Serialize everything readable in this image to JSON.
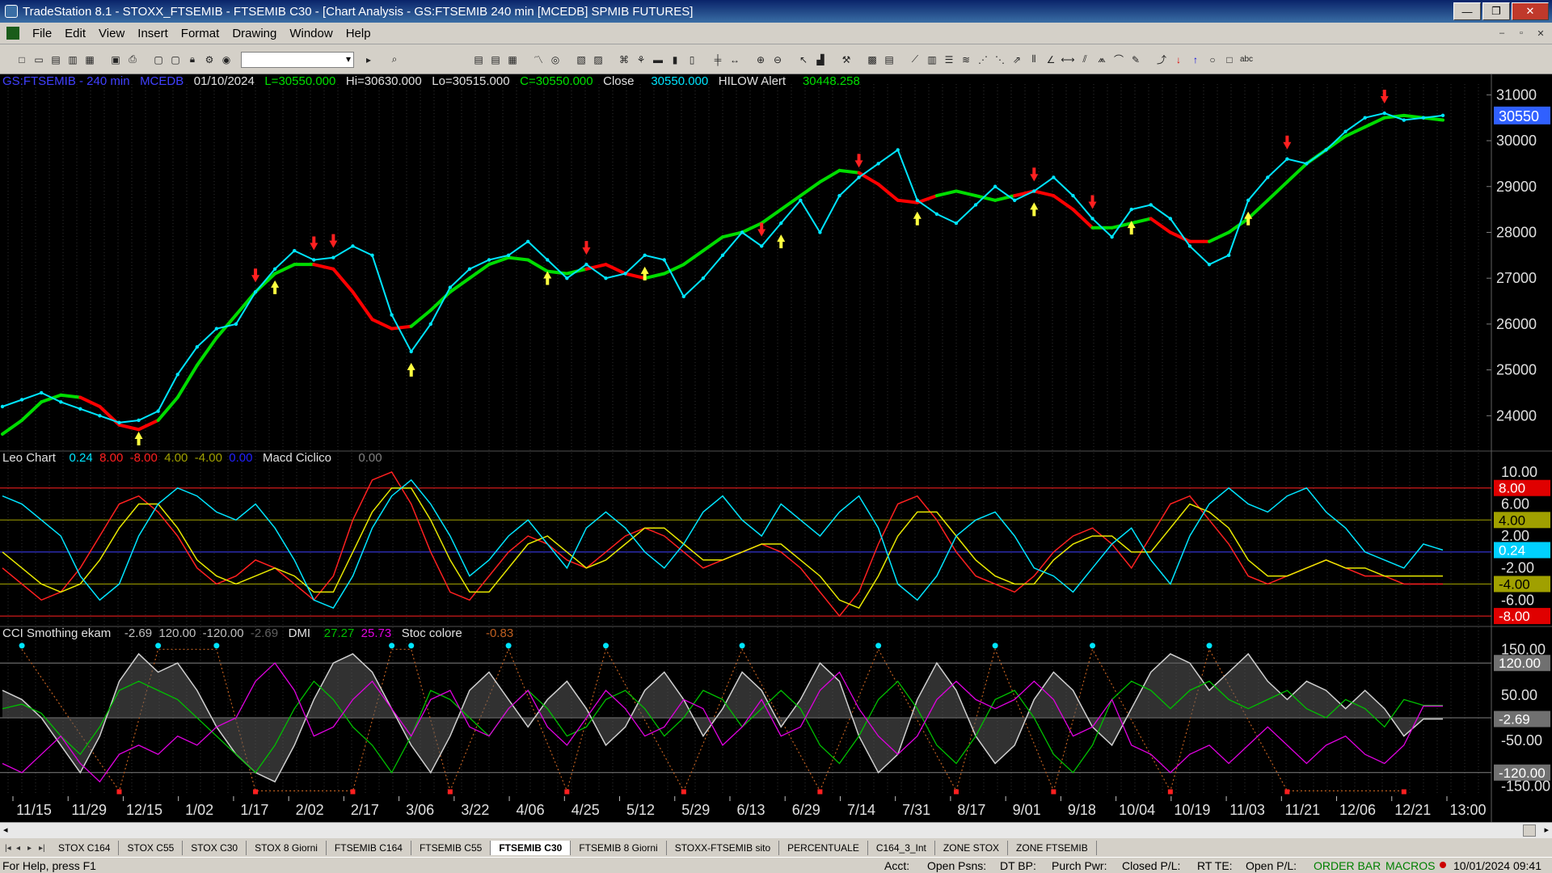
{
  "window": {
    "title": "TradeStation 8.1 - STOXX_FTSEMIB - FTSEMIB C30 - [Chart Analysis - GS:FTSEMIB  240 min  [MCEDB] SPMIB FUTURES]",
    "minimize": "—",
    "restore": "❐",
    "close": "✕"
  },
  "menu": [
    "File",
    "Edit",
    "View",
    "Insert",
    "Format",
    "Drawing",
    "Window",
    "Help"
  ],
  "mdi": {
    "minimize": "–",
    "restore": "▫",
    "close": "✕"
  },
  "chart_header": {
    "symbol": "GS:FTSEMIB - 240 min",
    "datasource": "MCEDB",
    "date": "01/10/2024",
    "last": "L=30550.000",
    "high": "Hi=30630.000",
    "low": "Lo=30515.000",
    "close": "C=30550.000",
    "close_label": "Close",
    "close_value": "30550.000",
    "study": "HILOW Alert",
    "study_value": "30448.258"
  },
  "panel2_header": {
    "name": "Leo Chart",
    "v1": "0.24",
    "v2": "8.00",
    "v3": "-8.00",
    "v4": "4.00",
    "v5": "-4.00",
    "v6": "0.00",
    "name2": "Macd Ciclico",
    "v7": "0.00"
  },
  "panel3_header": {
    "name": "CCI Smothing ekam",
    "v1": "-2.69",
    "v2": "120.00",
    "v3": "-120.00",
    "v4": "-2.69",
    "name2": "DMI",
    "v5": "27.27",
    "v6": "25.73",
    "name3": "Stoc colore",
    "v7": "-0.83"
  },
  "colors": {
    "price": "#00e5ff",
    "ma_up": "#00dd00",
    "ma_down": "#ff0000",
    "osc_line": "#00e5ff",
    "signal_red": "#ff2020",
    "signal_yellow": "#e8e800",
    "dmi_plus": "#00c000",
    "dmi_minus": "#e000e0",
    "stoc": "#c06020"
  },
  "price_axis": [
    "31000",
    "30000",
    "29000",
    "28000",
    "27000",
    "26000",
    "25000",
    "24000"
  ],
  "price_current": "30550",
  "osc_axis": [
    "10.00",
    "6.00",
    "2.00",
    "-2.00",
    "-6.00"
  ],
  "osc_badges": [
    "8.00",
    "4.00",
    "0.24",
    "-4.00",
    "-8.00"
  ],
  "cci_axis": [
    "150.00",
    "50.00",
    "-50.00",
    "-150.00"
  ],
  "cci_badges": [
    "120.00",
    "-2.69",
    "-120.00"
  ],
  "date_axis": [
    "11/15",
    "11/29",
    "12/15",
    "1/02",
    "1/17",
    "2/02",
    "2/17",
    "3/06",
    "3/22",
    "4/06",
    "4/25",
    "5/12",
    "5/29",
    "6/13",
    "6/29",
    "7/14",
    "7/31",
    "8/17",
    "9/01",
    "9/18",
    "10/04",
    "10/19",
    "11/03",
    "11/21",
    "12/06",
    "12/21",
    "13:00"
  ],
  "tabs": [
    "STOX C164",
    "STOX C55",
    "STOX  C30",
    "STOX  8 Giorni",
    "FTSEMIB C164",
    "FTSEMIB C55",
    "FTSEMIB C30",
    "FTSEMIB  8 Giorni",
    "STOXX-FTSEMIB sito",
    "PERCENTUALE",
    "C164_3_Int",
    "ZONE STOX",
    "ZONE FTSEMIB"
  ],
  "active_tab": "FTSEMIB C30",
  "status": {
    "help": "For Help, press F1",
    "acct": "Acct:",
    "open_psns": "Open Psns:",
    "dt_bp": "DT BP:",
    "purch_pwr": "Purch Pwr:",
    "closed_pl": "Closed P/L:",
    "rt_te": "RT TE:",
    "open_pl": "Open P/L:",
    "order_bar": "ORDER BAR",
    "macros": "MACROS",
    "datetime": "10/01/2024 09:41"
  },
  "chart_data": {
    "type": "line",
    "x_ticks": [
      "11/15",
      "11/29",
      "12/15",
      "1/02",
      "1/17",
      "2/02",
      "2/17",
      "3/06",
      "3/22",
      "4/06",
      "4/25",
      "5/12",
      "5/29",
      "6/13",
      "6/29",
      "7/14",
      "7/31",
      "8/17",
      "9/01",
      "9/18",
      "10/04",
      "10/19",
      "11/03",
      "11/21",
      "12/06",
      "12/21",
      "13:00"
    ],
    "price": {
      "ylim": [
        23300,
        31200
      ],
      "close": [
        24200,
        24350,
        24500,
        24300,
        24150,
        24000,
        23850,
        23900,
        24100,
        24900,
        25500,
        25900,
        26000,
        26700,
        27200,
        27600,
        27400,
        27450,
        27700,
        27500,
        26200,
        25400,
        26000,
        26800,
        27200,
        27400,
        27500,
        27800,
        27400,
        27000,
        27300,
        27000,
        27100,
        27500,
        27400,
        26600,
        27000,
        27500,
        28000,
        27700,
        28200,
        28700,
        28000,
        28800,
        29200,
        29500,
        29800,
        28700,
        28400,
        28200,
        28600,
        29000,
        28700,
        28900,
        29200,
        28800,
        28300,
        27900,
        28500,
        28600,
        28300,
        27700,
        27300,
        27500,
        28700,
        29200,
        29600,
        29500,
        29800,
        30200,
        30500,
        30600,
        30450,
        30500,
        30550
      ],
      "hilow": [
        23600,
        23900,
        24300,
        24450,
        24400,
        24200,
        23800,
        23700,
        23900,
        24400,
        25100,
        25700,
        26200,
        26700,
        27100,
        27300,
        27300,
        27200,
        26700,
        26100,
        25900,
        25950,
        26300,
        26700,
        27000,
        27300,
        27450,
        27400,
        27150,
        27100,
        27200,
        27300,
        27100,
        27000,
        27100,
        27300,
        27600,
        27900,
        28000,
        28200,
        28500,
        28800,
        29100,
        29350,
        29300,
        29050,
        28700,
        28650,
        28800,
        28900,
        28800,
        28700,
        28800,
        28900,
        28800,
        28500,
        28100,
        28100,
        28200,
        28300,
        28000,
        27800,
        27800,
        28000,
        28300,
        28700,
        29100,
        29500,
        29800,
        30100,
        30300,
        30500,
        30550,
        30500,
        30450
      ],
      "hilow_down_segments": [
        [
          4,
          8
        ],
        [
          16,
          21
        ],
        [
          30,
          33
        ],
        [
          44,
          48
        ],
        [
          52,
          56
        ],
        [
          59,
          62
        ]
      ],
      "sell_signals_idx": [
        13,
        16,
        17,
        30,
        39,
        44,
        53,
        56,
        66,
        71
      ],
      "buy_signals_idx": [
        7,
        14,
        21,
        28,
        33,
        40,
        47,
        53,
        58,
        64
      ]
    },
    "oscillator": {
      "ylim": [
        -9,
        11
      ],
      "levels": [
        8,
        4,
        0,
        -4,
        -8
      ],
      "leo": [
        7,
        6,
        4,
        2,
        -3,
        -6,
        -4,
        2,
        6,
        8,
        7,
        5,
        4,
        6,
        3,
        -1,
        -6,
        -7,
        -3,
        3,
        7,
        9,
        6,
        2,
        -3,
        -1,
        2,
        4,
        1,
        -2,
        3,
        5,
        3,
        0,
        -2,
        1,
        5,
        7,
        4,
        2,
        6,
        4,
        2,
        5,
        7,
        3,
        -4,
        -6,
        -3,
        2,
        4,
        5,
        2,
        -2,
        -3,
        -5,
        -2,
        1,
        3,
        -1,
        -4,
        2,
        6,
        8,
        6,
        5,
        7,
        8,
        5,
        3,
        0,
        -1,
        -2,
        1,
        0.24
      ],
      "macd_red": [
        -2,
        -4,
        -6,
        -5,
        -2,
        2,
        6,
        7,
        5,
        2,
        -2,
        -4,
        -3,
        -1,
        -2,
        -4,
        -6,
        -3,
        4,
        9,
        10,
        6,
        0,
        -5,
        -6,
        -3,
        0,
        2,
        1,
        -1,
        -2,
        0,
        2,
        3,
        2,
        0,
        -2,
        -1,
        0,
        1,
        0,
        -2,
        -5,
        -8,
        -5,
        1,
        6,
        7,
        4,
        0,
        -3,
        -4,
        -5,
        -3,
        0,
        2,
        3,
        1,
        -2,
        2,
        6,
        7,
        4,
        1,
        -3,
        -4,
        -3,
        -2,
        -1,
        -2,
        -3,
        -3,
        -4,
        -4,
        -4
      ],
      "macd_yellow": [
        0,
        -2,
        -4,
        -5,
        -4,
        -1,
        3,
        6,
        6,
        3,
        -1,
        -3,
        -4,
        -3,
        -2,
        -3,
        -5,
        -5,
        0,
        5,
        8,
        8,
        4,
        -1,
        -5,
        -5,
        -2,
        1,
        2,
        0,
        -2,
        -1,
        1,
        3,
        3,
        1,
        -1,
        -1,
        0,
        1,
        1,
        -1,
        -3,
        -6,
        -7,
        -3,
        2,
        5,
        5,
        2,
        -1,
        -3,
        -4,
        -4,
        -1,
        1,
        2,
        2,
        0,
        0,
        3,
        6,
        5,
        3,
        -1,
        -3,
        -3,
        -2,
        -1,
        -2,
        -2,
        -3,
        -3,
        -3,
        -3
      ]
    },
    "cci": {
      "ylim": [
        -170,
        170
      ],
      "levels": [
        120,
        0,
        -120
      ],
      "cci": [
        60,
        40,
        0,
        -60,
        -120,
        -40,
        80,
        140,
        100,
        120,
        60,
        -20,
        -80,
        -120,
        -140,
        -60,
        40,
        120,
        140,
        100,
        20,
        -60,
        -120,
        -40,
        60,
        100,
        40,
        -20,
        40,
        80,
        20,
        -60,
        -20,
        60,
        100,
        40,
        -40,
        20,
        100,
        60,
        -20,
        40,
        120,
        80,
        -40,
        -120,
        -80,
        40,
        120,
        60,
        -40,
        -100,
        -60,
        40,
        100,
        60,
        -20,
        -60,
        20,
        100,
        140,
        120,
        60,
        100,
        140,
        80,
        40,
        80,
        60,
        20,
        60,
        20,
        -40,
        -2.69,
        -2.69
      ],
      "dmi_plus": [
        20,
        30,
        10,
        -40,
        -80,
        -20,
        60,
        80,
        60,
        40,
        0,
        -40,
        -80,
        -120,
        -60,
        20,
        80,
        40,
        -20,
        -60,
        -120,
        -40,
        60,
        40,
        0,
        -40,
        20,
        60,
        20,
        -40,
        -20,
        40,
        60,
        20,
        -40,
        0,
        60,
        40,
        -20,
        20,
        60,
        20,
        -60,
        -100,
        -40,
        40,
        80,
        20,
        -60,
        -100,
        -40,
        40,
        60,
        0,
        -80,
        -120,
        -60,
        40,
        80,
        60,
        20,
        60,
        80,
        40,
        20,
        40,
        60,
        20,
        0,
        40,
        20,
        -20,
        40,
        27.27,
        27.27
      ],
      "dmi_minus": [
        -100,
        -120,
        -80,
        -40,
        -100,
        -140,
        -80,
        -60,
        -80,
        -40,
        -60,
        -20,
        0,
        80,
        120,
        60,
        -40,
        -20,
        40,
        80,
        20,
        -40,
        40,
        60,
        -20,
        -40,
        20,
        60,
        -20,
        -60,
        0,
        60,
        20,
        -40,
        -20,
        40,
        20,
        -60,
        -20,
        40,
        -40,
        -20,
        60,
        100,
        20,
        -40,
        -80,
        -40,
        40,
        80,
        40,
        20,
        40,
        80,
        40,
        -40,
        -20,
        40,
        -60,
        -80,
        -120,
        -80,
        -60,
        -100,
        -60,
        -20,
        -60,
        -100,
        -60,
        -40,
        -80,
        -100,
        -60,
        25.73,
        25.73
      ],
      "stoc_peaks_idx": [
        1,
        8,
        11,
        20,
        21,
        26,
        31,
        38,
        45,
        51,
        56,
        62
      ],
      "stoc_troughs_idx": [
        6,
        13,
        18,
        23,
        29,
        35,
        42,
        49,
        54,
        60,
        66,
        72
      ]
    }
  }
}
